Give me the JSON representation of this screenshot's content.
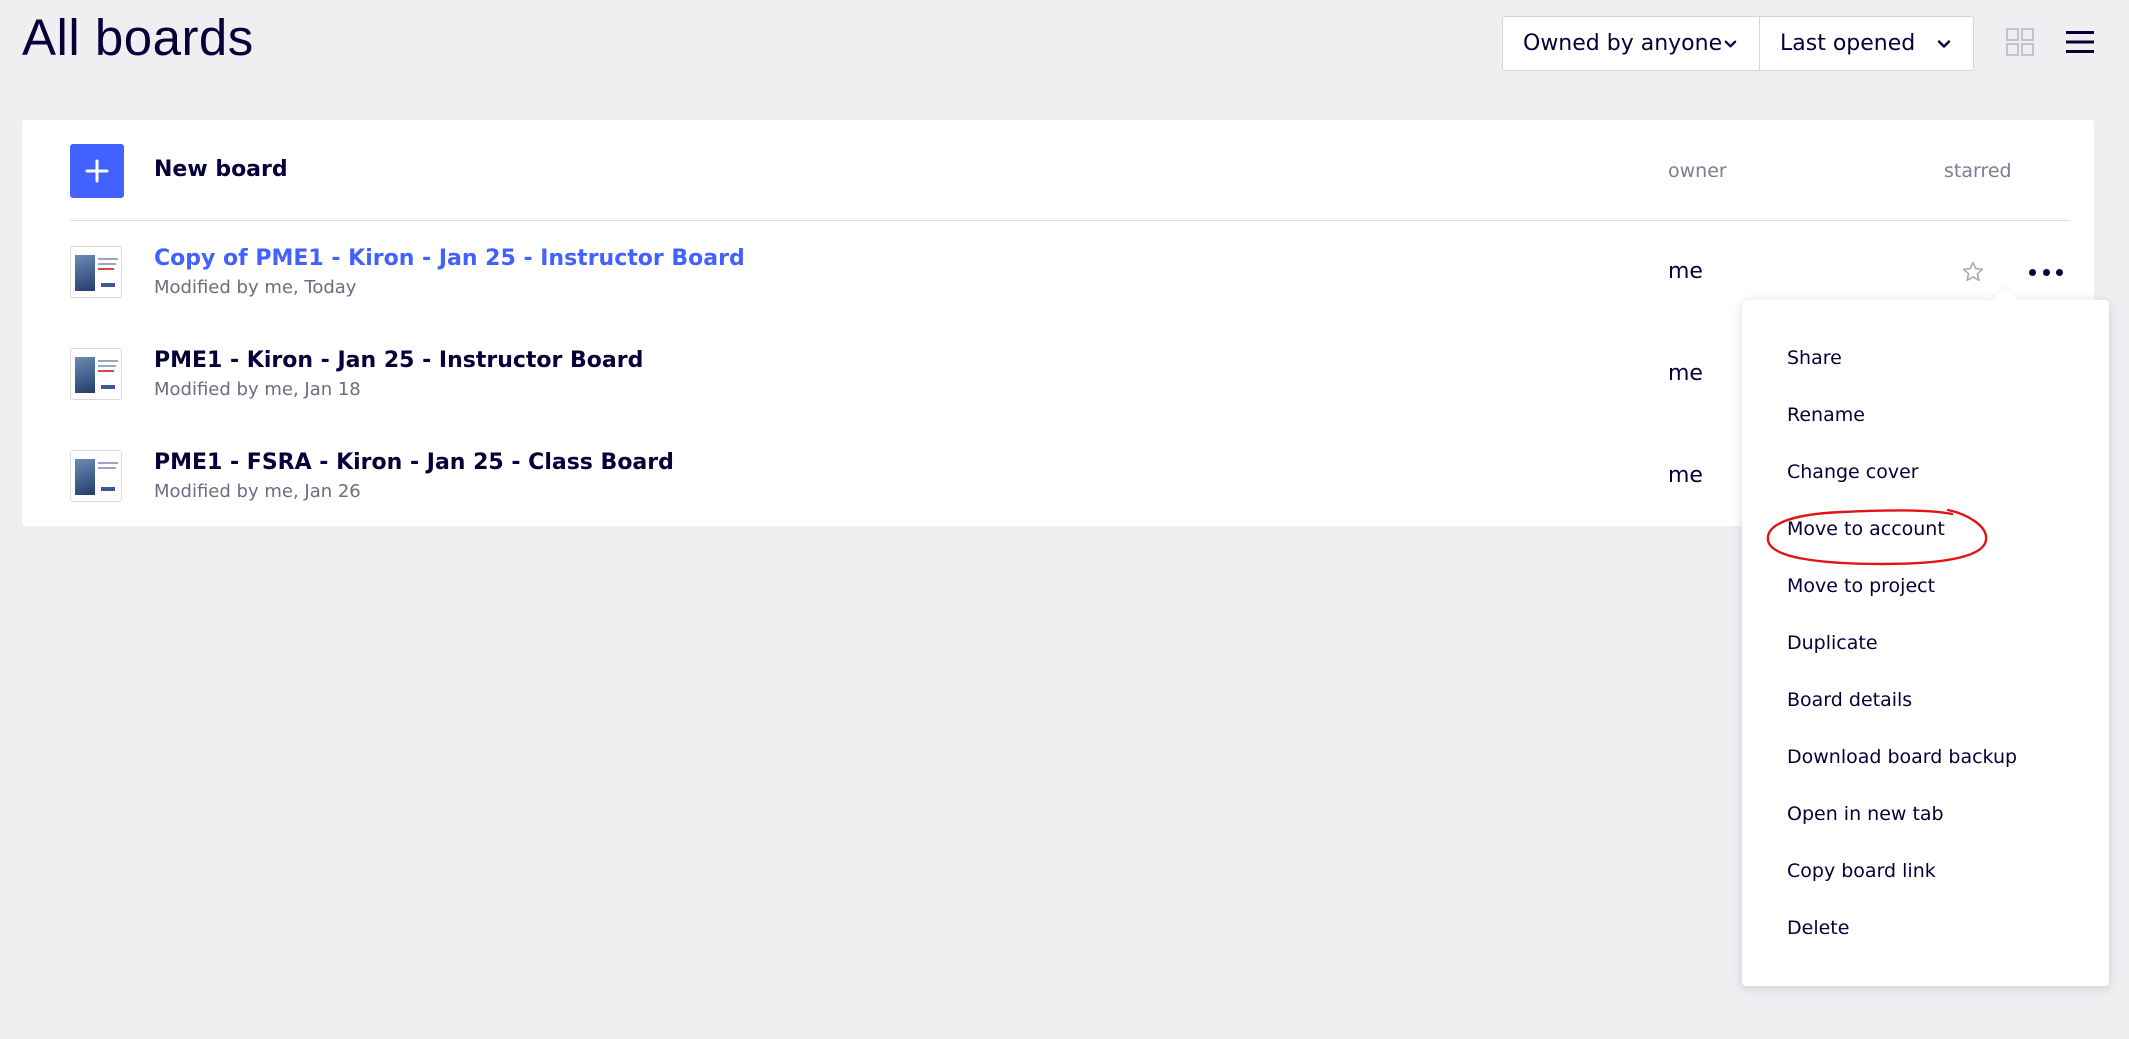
{
  "page": {
    "title": "All boards"
  },
  "filters": {
    "owner": "Owned by anyone",
    "sort": "Last opened"
  },
  "toolbar": {
    "grid_view_icon": "grid-icon",
    "menu_icon": "hamburger-icon"
  },
  "list": {
    "new_board_label": "New board",
    "columns": {
      "owner": "owner",
      "starred": "starred"
    },
    "boards": [
      {
        "title": "Copy of PME1 - Kiron - Jan 25 - Instructor Board",
        "modified": "Modified by me, Today",
        "owner": "me",
        "active": true
      },
      {
        "title": "PME1 - Kiron - Jan 25 - Instructor Board",
        "modified": "Modified by me, Jan 18",
        "owner": "me",
        "active": false
      },
      {
        "title": "PME1 - FSRA - Kiron - Jan 25 - Class Board",
        "modified": "Modified by me, Jan 26",
        "owner": "me",
        "active": false
      }
    ]
  },
  "context_menu": {
    "items": [
      "Share",
      "Rename",
      "Change cover",
      "Move to account",
      "Move to project",
      "Duplicate",
      "Board details",
      "Download board backup",
      "Open in new tab",
      "Copy board link",
      "Delete"
    ],
    "highlighted_item": "Move to account"
  },
  "colors": {
    "accent": "#4262ff",
    "text": "#050038",
    "annotation": "#e01414"
  }
}
